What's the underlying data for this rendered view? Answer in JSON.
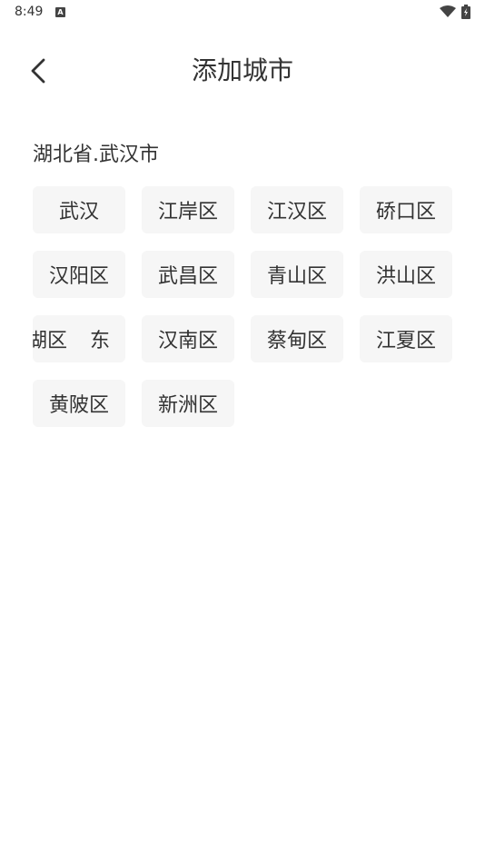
{
  "status_bar": {
    "time": "8:49",
    "notification_icon": "a-box-icon",
    "wifi_icon": "wifi-icon",
    "battery_icon": "battery-icon"
  },
  "header": {
    "back_icon": "chevron-left-icon",
    "title": "添加城市"
  },
  "region_label": "湖北省.武汉市",
  "districts": [
    "武汉",
    "江岸区",
    "江汉区",
    "硚口区",
    "汉阳区",
    "武昌区",
    "青山区",
    "洪山区",
    "湖区 东",
    "汉南区",
    "蔡甸区",
    "江夏区",
    "黄陂区",
    "新洲区"
  ],
  "colors": {
    "chip_bg": "#f6f6f6",
    "text": "#333333",
    "background": "#ffffff"
  }
}
